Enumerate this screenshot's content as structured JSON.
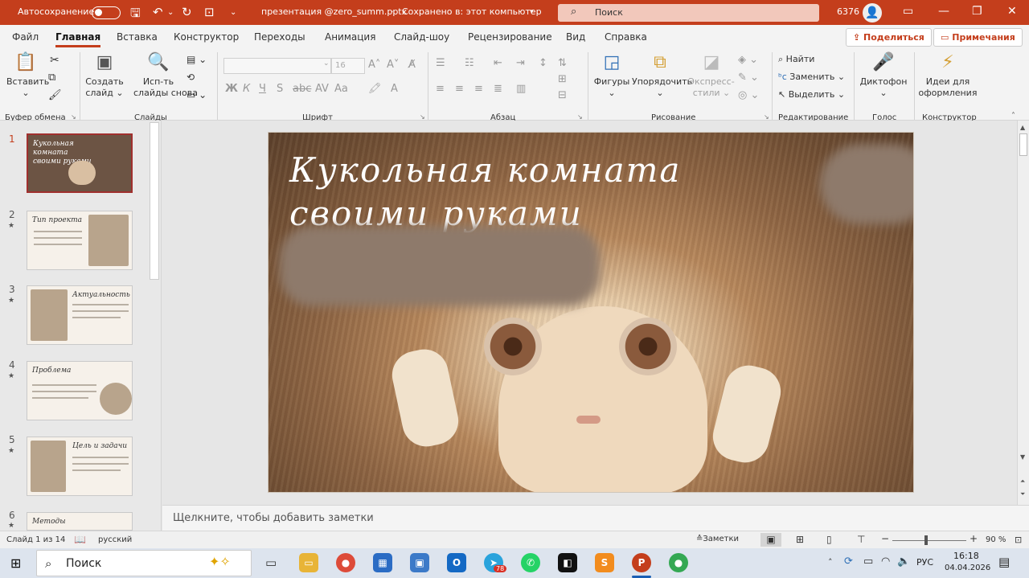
{
  "titlebar": {
    "autosave": "Автосохранение",
    "filename": "презентация @zero_summ.pptx",
    "saved": "Сохранено в: этот компьютер",
    "search": "Поиск",
    "user_id": "6376"
  },
  "tabs": [
    "Файл",
    "Главная",
    "Вставка",
    "Конструктор",
    "Переходы",
    "Анимация",
    "Слайд-шоу",
    "Рецензирование",
    "Вид",
    "Справка"
  ],
  "share": "Поделиться",
  "comments": "Примечания",
  "ribbon": {
    "paste": "Вставить",
    "create_slide_1": "Создать",
    "create_slide_2": "слайд",
    "reuse_1": "Исп-ть",
    "reuse_2": "слайды снова",
    "font_size": "16",
    "shapes": "Фигуры",
    "arrange": "Упорядочить",
    "quick_styles_1": "Экспресс-",
    "quick_styles_2": "стили",
    "find": "Найти",
    "replace": "Заменить",
    "select": "Выделить",
    "dictate": "Диктофон",
    "designer_1": "Идеи для",
    "designer_2": "оформления",
    "groups": {
      "clipboard": "Буфер обмена",
      "slides": "Слайды",
      "font": "Шрифт",
      "paragraph": "Абзац",
      "drawing": "Рисование",
      "editing": "Редактирование",
      "voice": "Голос",
      "designer": "Конструктор"
    }
  },
  "thumbnails": [
    {
      "num": "1",
      "title": "Кукольная комната своими руками"
    },
    {
      "num": "2",
      "title": "Тип проекта"
    },
    {
      "num": "3",
      "title": "Актуальность"
    },
    {
      "num": "4",
      "title": "Проблема"
    },
    {
      "num": "5",
      "title": "Цель и задачи"
    },
    {
      "num": "6",
      "title": "Методы"
    }
  ],
  "slide": {
    "title_line1": "Кукольная комната",
    "title_line2": "своими руками"
  },
  "notes_placeholder": "Щелкните, чтобы добавить заметки",
  "status": {
    "slide_of": "Слайд 1 из 14",
    "language": "русский",
    "notes": "Заметки",
    "zoom": "90 %"
  },
  "taskbar": {
    "search": "Поиск",
    "lang": "РУС",
    "time": "16:18",
    "date": "04.04.2026",
    "badge": "78"
  },
  "colors": {
    "accent": "#c43e1c",
    "titlebar": "#c43e1c"
  }
}
